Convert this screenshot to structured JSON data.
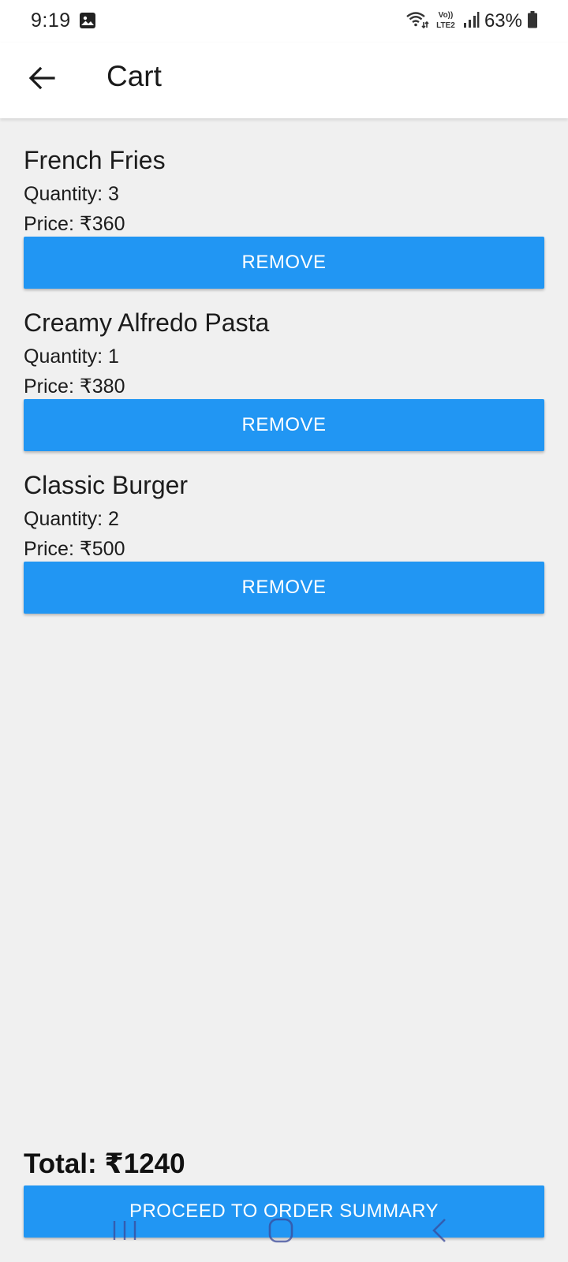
{
  "status_bar": {
    "time": "9:19",
    "network_label": "Vo)) LTE2",
    "battery": "63%",
    "icons": [
      "gallery-icon",
      "wifi-icon",
      "volte-icon",
      "signal-icon",
      "battery-icon"
    ]
  },
  "app_bar": {
    "title": "Cart",
    "back_icon": "arrow-left-icon"
  },
  "cart": {
    "items": [
      {
        "name": "French Fries",
        "quantity": "Quantity: 3",
        "price": "Price: ₹360",
        "remove_label": "REMOVE"
      },
      {
        "name": "Creamy Alfredo Pasta",
        "quantity": "Quantity: 1",
        "price": "Price: ₹380",
        "remove_label": "REMOVE"
      },
      {
        "name": "Classic Burger",
        "quantity": "Quantity: 2",
        "price": "Price: ₹500",
        "remove_label": "REMOVE"
      }
    ]
  },
  "footer": {
    "total": "Total: ₹1240",
    "proceed_label": "PROCEED TO ORDER SUMMARY"
  },
  "nav_bar": {
    "icons": [
      "recents-icon",
      "home-icon",
      "back-nav-icon"
    ]
  },
  "colors": {
    "primary": "#2196f3",
    "background": "#f0f0f0",
    "surface": "#ffffff"
  }
}
